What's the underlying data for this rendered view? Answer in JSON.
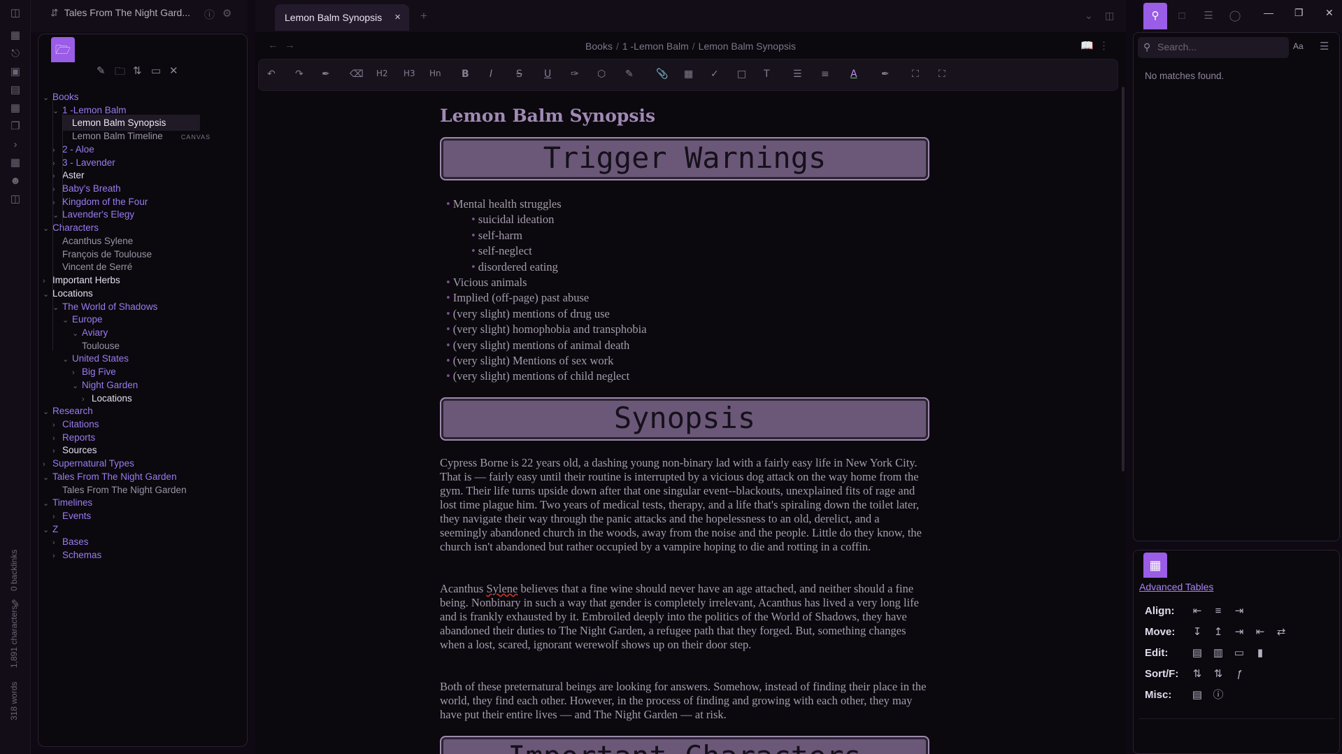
{
  "vault": {
    "name": "Tales From The Night Gard..."
  },
  "ribbon": {
    "backlinks": "0 backlinks",
    "word_count": "318 words",
    "char_count": "1,891 characters"
  },
  "tab": {
    "title": "Lemon Balm Synopsis",
    "close": "×",
    "new": "+"
  },
  "breadcrumb": {
    "part1": "Books",
    "part2": "1 -Lemon Balm",
    "part3": "Lemon Balm Synopsis",
    "sep": "/"
  },
  "toolbar": {
    "h2": "H2",
    "h3": "H3",
    "hn": "Hn",
    "bold": "B",
    "italic": "I",
    "strike": "S",
    "underline": "U",
    "font_color": "A"
  },
  "tree": [
    {
      "label": "Books",
      "kind": "folder"
    },
    {
      "label": "1 -Lemon Balm",
      "kind": "folder"
    },
    {
      "label": "Lemon Balm Synopsis",
      "kind": "file",
      "active": true
    },
    {
      "label": "Lemon Balm Timeline",
      "kind": "file",
      "tag": "CANVAS"
    },
    {
      "label": "2 - Aloe",
      "kind": "folder"
    },
    {
      "label": "3 - Lavender",
      "kind": "folder"
    },
    {
      "label": "Aster",
      "kind": "folder-white"
    },
    {
      "label": "Baby's Breath",
      "kind": "folder"
    },
    {
      "label": "Kingdom of the Four",
      "kind": "folder"
    },
    {
      "label": "Lavender's Elegy",
      "kind": "folder"
    },
    {
      "label": "Characters",
      "kind": "folder"
    },
    {
      "label": "Acanthus Sylene",
      "kind": "file"
    },
    {
      "label": "François de Toulouse",
      "kind": "file"
    },
    {
      "label": "Vincent de Serré",
      "kind": "file"
    },
    {
      "label": "Important Herbs",
      "kind": "folder-white"
    },
    {
      "label": "Locations",
      "kind": "folder-white"
    },
    {
      "label": "The World of Shadows",
      "kind": "folder"
    },
    {
      "label": "Europe",
      "kind": "folder"
    },
    {
      "label": "Aviary",
      "kind": "folder"
    },
    {
      "label": "Toulouse",
      "kind": "file"
    },
    {
      "label": "United States",
      "kind": "folder"
    },
    {
      "label": "Big Five",
      "kind": "folder"
    },
    {
      "label": "Night Garden",
      "kind": "folder"
    },
    {
      "label": "Locations",
      "kind": "folder-white"
    },
    {
      "label": "Research",
      "kind": "folder"
    },
    {
      "label": "Citations",
      "kind": "folder"
    },
    {
      "label": "Reports",
      "kind": "folder"
    },
    {
      "label": "Sources",
      "kind": "folder-white"
    },
    {
      "label": "Supernatural Types",
      "kind": "folder"
    },
    {
      "label": "Tales From The Night Garden",
      "kind": "folder"
    },
    {
      "label": "Tales From The Night Garden",
      "kind": "file"
    },
    {
      "label": "Timelines",
      "kind": "folder"
    },
    {
      "label": "Events",
      "kind": "folder"
    },
    {
      "label": "Z",
      "kind": "folder"
    },
    {
      "label": "Bases",
      "kind": "folder"
    },
    {
      "label": "Schemas",
      "kind": "folder"
    }
  ],
  "doc": {
    "title": "Lemon Balm Synopsis",
    "banner1": "Trigger Warnings",
    "warnings": [
      {
        "text": "Mental health struggles",
        "level": 1
      },
      {
        "text": "suicidal ideation",
        "level": 2
      },
      {
        "text": "self-harm",
        "level": 2
      },
      {
        "text": "self-neglect",
        "level": 2
      },
      {
        "text": "disordered eating",
        "level": 2
      },
      {
        "text": "Vicious animals",
        "level": 1
      },
      {
        "text": "Implied (off-page) past abuse",
        "level": 1
      },
      {
        "text": "(very slight) mentions of drug use",
        "level": 1
      },
      {
        "text": "(very slight) homophobia and transphobia",
        "level": 1
      },
      {
        "text": "(very slight) mentions of animal death",
        "level": 1
      },
      {
        "text": "(very slight) Mentions of sex work",
        "level": 1
      },
      {
        "text": "(very slight) mentions of child neglect",
        "level": 1
      }
    ],
    "banner2": "Synopsis",
    "para1": "Cypress Borne is 22 years old, a dashing young non-binary lad with a fairly easy life in New York City. That is — fairly easy until their routine is interrupted by a vicious dog attack on the way home from the gym. Their life turns upside down after that one singular event--blackouts, unexplained fits of rage and lost time plague him. Two years of medical tests, therapy, and a life that's spiraling down the toilet later, they navigate their way through the panic attacks and the hopelessness to an old, derelict, and a seemingly abandoned church in the woods, away from the noise and the people. Little do they know, the church isn't abandoned but rather occupied by a vampire hoping to die and rotting in a coffin.",
    "para2_a": "Acanthus ",
    "para2_b": "Sylene",
    "para2_c": " believes that a fine wine should never have an age attached, and neither should a fine being. Nonbinary in such a way that gender is completely irrelevant, Acanthus has lived a very long life and is frankly exhausted by it. Embroiled deeply into the politics of the World of Shadows, they have abandoned their duties to The Night Garden, a refugee path that they forged. But, something changes when a lost, scared, ignorant werewolf shows up on their door step.",
    "para3": "Both of these preternatural beings are looking for answers. Somehow, instead of finding their place in the world, they find each other. However, in the process of finding and growing with each other, they may have put their entire lives — and The Night Garden — at risk.",
    "banner3": "Important Characters"
  },
  "search": {
    "placeholder": "Search...",
    "case_toggle": "Aa",
    "empty": "No matches found."
  },
  "advanced_tables": {
    "link": "Advanced Tables",
    "align": "Align:",
    "move": "Move:",
    "edit": "Edit:",
    "sort": "Sort/F:",
    "misc": "Misc:"
  },
  "colors": {
    "accent": "#9a5de6",
    "banner_bg": "#6b5878",
    "link": "#9a7cf0"
  }
}
